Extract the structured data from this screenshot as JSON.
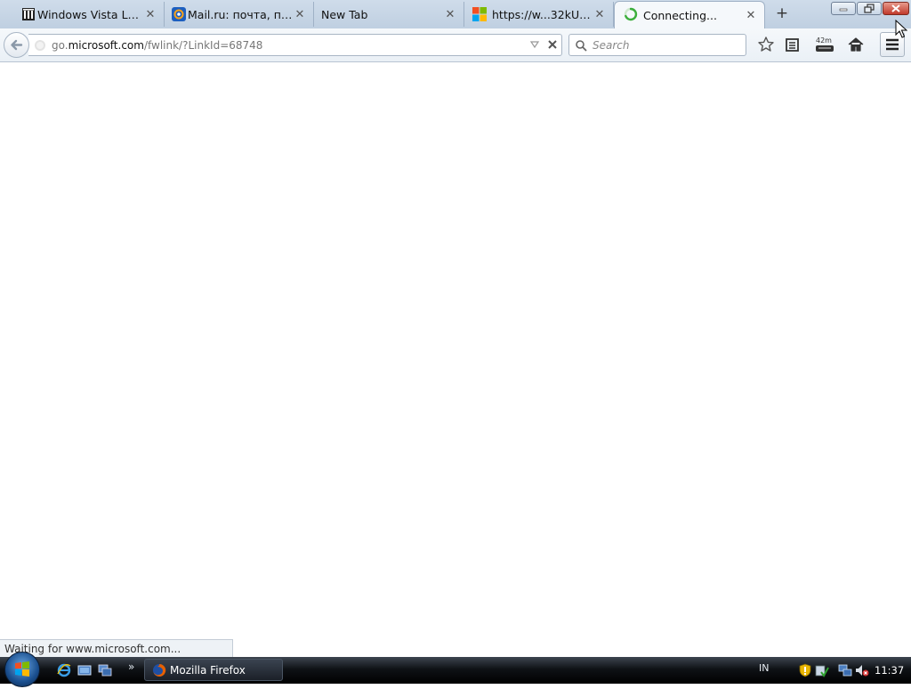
{
  "tabs": [
    {
      "title": "Windows Vista Lan...",
      "icon": "vista-landmark-icon",
      "active": false
    },
    {
      "title": "Mail.ru: почта, пои...",
      "icon": "mailru-at-icon",
      "active": false
    },
    {
      "title": "New Tab",
      "icon": "",
      "active": false
    },
    {
      "title": "https://w...32kUz.8.0",
      "icon": "microsoft-logo-icon",
      "active": false
    },
    {
      "title": "Connecting...",
      "icon": "loading-spinner-icon",
      "active": true
    }
  ],
  "tab_close_glyph": "✕",
  "new_tab_glyph": "+",
  "url": {
    "prefix": "go.",
    "host": "microsoft.com",
    "path": "/fwlink/?LinkId=68748"
  },
  "search": {
    "placeholder": "Search"
  },
  "toolbar": {
    "pocket_label": "42m"
  },
  "status": {
    "text": "Waiting for www.microsoft.com..."
  },
  "taskbar": {
    "quicklaunch_more": "»",
    "window_label": "Mozilla Firefox",
    "language": "IN",
    "time": "11:37"
  },
  "colors": {
    "accent": "#2b7cd3",
    "spinner": "#3cae3c",
    "close_button": "#c0392b"
  }
}
